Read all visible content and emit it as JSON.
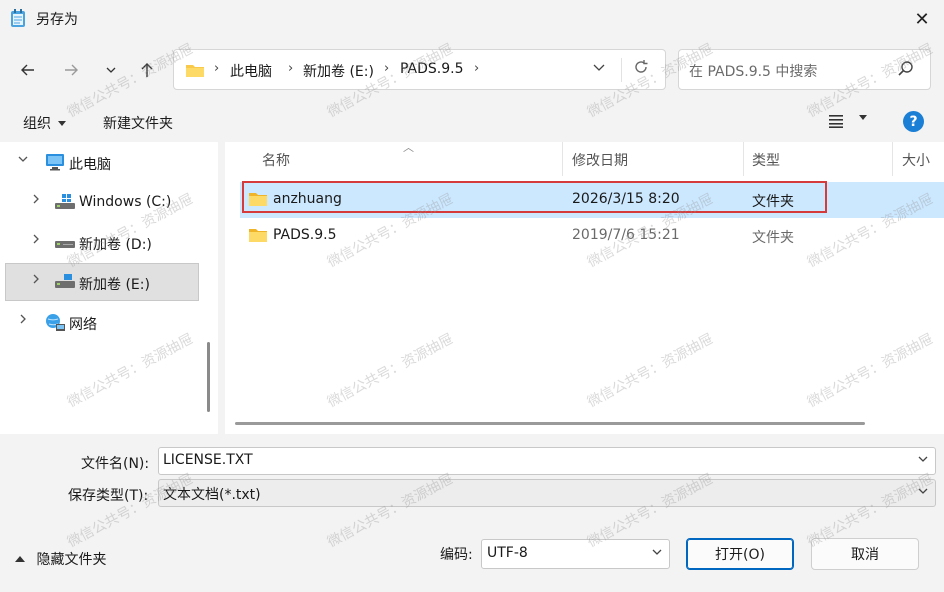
{
  "window": {
    "title": "另存为",
    "close_glyph": "✕"
  },
  "nav": {
    "breadcrumbs": [
      "此电脑",
      "新加卷 (E:)",
      "PADS.9.5"
    ],
    "search_placeholder": "在 PADS.9.5 中搜索"
  },
  "toolbar": {
    "organize": "组织",
    "new_folder": "新建文件夹"
  },
  "sidebar": {
    "items": [
      {
        "label": "此电脑",
        "icon": "computer-icon"
      },
      {
        "label": "Windows (C:)",
        "icon": "drive-icon"
      },
      {
        "label": "新加卷 (D:)",
        "icon": "drive-icon"
      },
      {
        "label": "新加卷 (E:)",
        "icon": "drive-icon"
      },
      {
        "label": "网络",
        "icon": "network-icon"
      }
    ]
  },
  "files": {
    "columns": [
      "名称",
      "修改日期",
      "类型",
      "大小"
    ],
    "rows": [
      {
        "name": "anzhuang",
        "date": "2026/3/15 8:20",
        "type": "文件夹"
      },
      {
        "name": "PADS.9.5",
        "date": "2019/7/6 15:21",
        "type": "文件夹"
      }
    ]
  },
  "form": {
    "filename_label": "文件名(N):",
    "filename_value": "LICENSE.TXT",
    "filetype_label": "保存类型(T):",
    "filetype_value": "文本文档(*.txt)",
    "hide_folders": "隐藏文件夹",
    "encoding_label": "编码:",
    "encoding_value": "UTF-8",
    "open_button": "打开(O)",
    "cancel_button": "取消"
  },
  "watermark_text": "微信公共号：资源抽屉",
  "colors": {
    "selection": "#cce8ff",
    "highlight_box": "#d63b3b",
    "accent": "#0067c0",
    "help": "#1b7fd6"
  }
}
